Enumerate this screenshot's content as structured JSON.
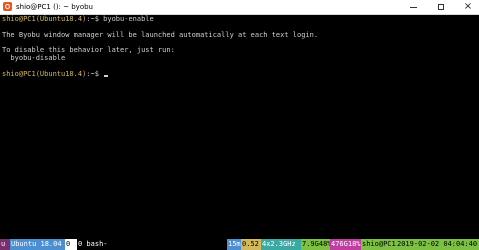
{
  "window": {
    "title": "shio@PC1 (): ~ byobu"
  },
  "terminal": {
    "line1_host": "shio@PC1(Ubuntu18.4)",
    "line1_path": ":~$ ",
    "line1_cmd": "byobu-enable",
    "line2": "The Byobu window manager will be launched automatically at each text login.",
    "line3": "To disable this behavior later, just run:",
    "line4": "  byobu-disable",
    "line5_host": "shio@PC1(Ubuntu18.4)",
    "line5_path": ":~$ "
  },
  "statusbar": {
    "logo": "u",
    "os": "Ubuntu 18.04",
    "window_index": "0",
    "window_label": "0 bash-",
    "uptime": "15m",
    "load": "0.52",
    "cpu": "4x2.3GHz",
    "mem": "7.9G48%",
    "disk": "476G18%",
    "host": "shio@PC1",
    "datetime": "2019-02-02 04:04:40"
  },
  "colors": {
    "status_green": "#7cc142",
    "status_blue": "#4a8fd1",
    "status_teal": "#3aa9a3",
    "prompt_host": "#d4b95a"
  }
}
